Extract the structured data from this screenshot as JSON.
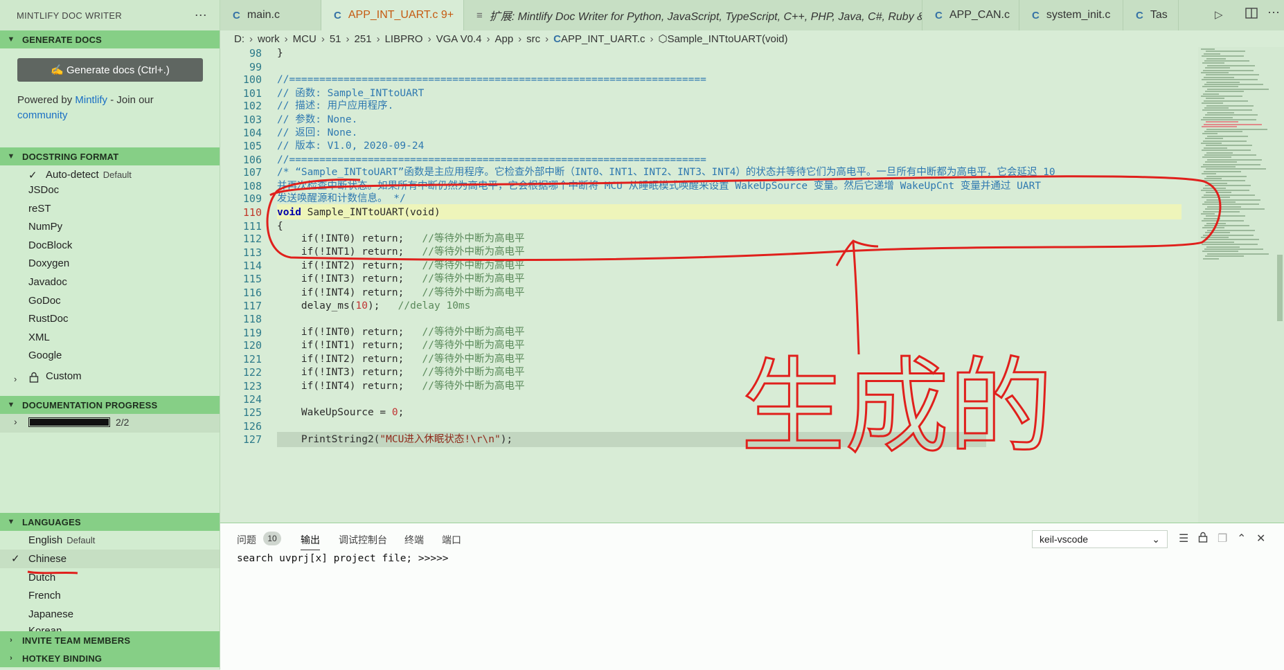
{
  "sidebar": {
    "title": "MINTLIFY DOC WRITER",
    "more_icon": "⋯",
    "generate_docs": {
      "header": "GENERATE DOCS",
      "button_label": "✍ Generate docs (Ctrl+.)",
      "powered_prefix": "Powered by ",
      "mintlify_link": "Mintlify",
      "powered_suffix": " - Join our",
      "community_link": "community"
    },
    "docstring_format": {
      "header": "DOCSTRING FORMAT",
      "autodetect": "Auto-detect",
      "autodetect_tag": "Default",
      "items": [
        "JSDoc",
        "reST",
        "NumPy",
        "DocBlock",
        "Doxygen",
        "Javadoc",
        "GoDoc",
        "RustDoc",
        "XML",
        "Google"
      ],
      "custom": "Custom"
    },
    "documentation_progress": {
      "header": "DOCUMENTATION PROGRESS",
      "progress_text": "2/2",
      "progress_fraction": 1.0
    },
    "languages": {
      "header": "LANGUAGES",
      "english": "English",
      "english_tag": "Default",
      "items": [
        "Chinese",
        "Dutch",
        "French",
        "Japanese"
      ],
      "partial_item": "Korean",
      "selected": "Chinese"
    },
    "invite_header": "INVITE TEAM MEMBERS",
    "hotkey_header": "HOTKEY BINDING"
  },
  "tabs": [
    {
      "icon": "C",
      "label": "main.c",
      "active": false
    },
    {
      "icon": "C",
      "label": "APP_INT_UART.c 9+",
      "active": true,
      "close": "✕"
    },
    {
      "icon": "≡",
      "label": "扩展: Mintlify Doc Writer for Python, JavaScript, TypeScript, C++, PHP, Java, C#, Ruby & more",
      "active": false
    },
    {
      "icon": "C",
      "label": "APP_CAN.c",
      "active": false
    },
    {
      "icon": "C",
      "label": "system_init.c",
      "active": false
    },
    {
      "icon": "C",
      "label": "Tas",
      "active": false
    }
  ],
  "breadcrumb": [
    "D:",
    "work",
    "MCU",
    "51",
    "251",
    "LIBPRO",
    "VGA V0.4",
    "App",
    "src",
    "APP_INT_UART.c",
    "Sample_INTtoUART(void)"
  ],
  "editor": {
    "line_numbers": [
      "98",
      "99",
      "100",
      "101",
      "102",
      "103",
      "104",
      "105",
      "106",
      "107",
      "108",
      "109",
      "110",
      "111",
      "112",
      "113",
      "114",
      "115",
      "116",
      "117",
      "118",
      "119",
      "120",
      "121",
      "122",
      "123",
      "124",
      "125",
      "126",
      "127"
    ],
    "current_line": "110",
    "lines": {
      "l98": "}",
      "l100": "//=====================================================================",
      "l101": "// 函数: Sample_INTtoUART",
      "l102": "// 描述: 用户应用程序.",
      "l103": "// 参数: None.",
      "l104": "// 返回: None.",
      "l105": "// 版本: V1.0, 2020-09-24",
      "l106": "//=====================================================================",
      "l107": "/* “Sample_INTtoUART”函数是主应用程序。它检查外部中断（INT0、INT1、INT2、INT3、INT4）的状态并等待它们为高电平。一旦所有中断都为高电平，它会延迟 10",
      "l108": "并再次检查中断状态。如果所有中断仍然为高电平，它会根据哪个中断将 MCU 从睡眠模式唤醒来设置 WakeUpSource 变量。然后它递增 WakeUpCnt 变量并通过 UART",
      "l109": "发送唤醒源和计数信息。 */",
      "l110_kw": "void",
      "l110_rest": " Sample_INTtoUART(void)",
      "l111": "{",
      "if_lines": [
        {
          "stmt": "    if(!INT0) return;",
          "cmt": "   //等待外中断为高电平"
        },
        {
          "stmt": "    if(!INT1) return;",
          "cmt": "   //等待外中断为高电平"
        },
        {
          "stmt": "    if(!INT2) return;",
          "cmt": "   //等待外中断为高电平"
        },
        {
          "stmt": "    if(!INT3) return;",
          "cmt": "   //等待外中断为高电平"
        },
        {
          "stmt": "    if(!INT4) return;",
          "cmt": "   //等待外中断为高电平"
        }
      ],
      "l117_fn": "    delay_ms(",
      "l117_num": "10",
      "l117_end": ");",
      "l117_cmt": "   //delay 10ms",
      "if_lines2": [
        {
          "stmt": "    if(!INT0) return;",
          "cmt": "   //等待外中断为高电平"
        },
        {
          "stmt": "    if(!INT1) return;",
          "cmt": "   //等待外中断为高电平"
        },
        {
          "stmt": "    if(!INT2) return;",
          "cmt": "   //等待外中断为高电平"
        },
        {
          "stmt": "    if(!INT3) return;",
          "cmt": "   //等待外中断为高电平"
        },
        {
          "stmt": "    if(!INT4) return;",
          "cmt": "   //等待外中断为高电平"
        }
      ],
      "l125_a": "    WakeUpSource = ",
      "l125_num": "0",
      "l125_b": ";",
      "l127_a": "    PrintString2(",
      "l127_str": "\"MCU进入休眠状态!\\r\\n\"",
      "l127_b": ");"
    }
  },
  "panel": {
    "tabs": [
      "问题",
      "输出",
      "调试控制台",
      "终端",
      "端口"
    ],
    "problems_count": "10",
    "active_tab": "输出",
    "dropdown_value": "keil-vscode",
    "output_text": "search uvprj[x] project file; >>>>>"
  },
  "annotation": {
    "handwritten_text": "生成的",
    "color": "#e0201c"
  },
  "colors": {
    "sidebar_bg": "#d2ecd0",
    "section_header": "#86cf86",
    "editor_bg": "#d8ecd6",
    "active_tab_text": "#c55a11"
  }
}
